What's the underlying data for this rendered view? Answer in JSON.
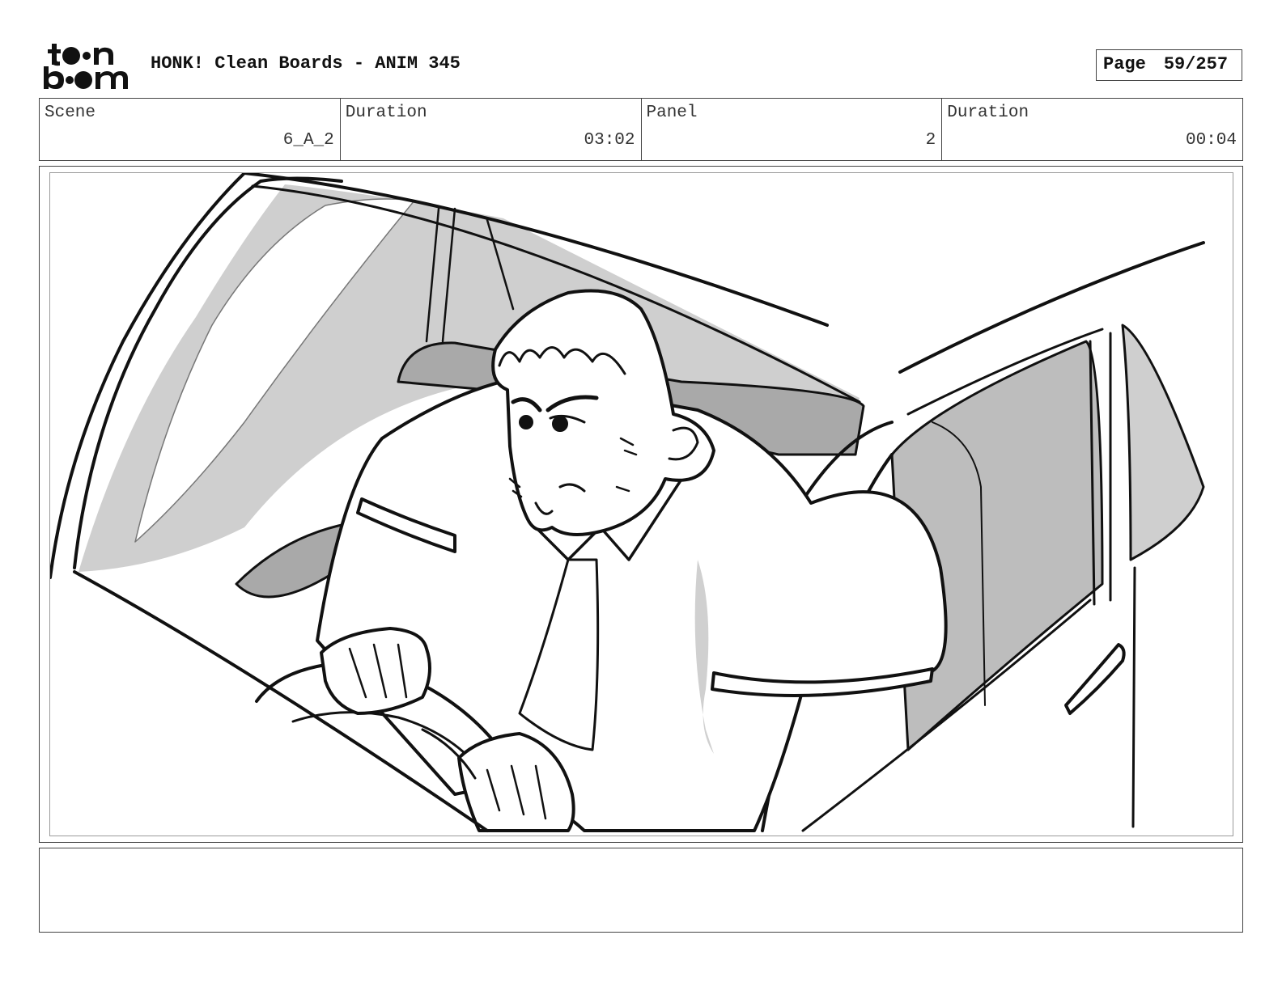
{
  "header": {
    "logo": "toon boom",
    "title": "HONK! Clean Boards - ANIM 345",
    "page_label": "Page",
    "page_number": "59/257"
  },
  "info": [
    {
      "label": "Scene",
      "value": "6_A_2"
    },
    {
      "label": "Duration",
      "value": "03:02"
    },
    {
      "label": "Panel",
      "value": "2"
    },
    {
      "label": "Duration",
      "value": "00:04"
    }
  ],
  "panel": {
    "image": "storyboard-drawing-man-driving-car"
  },
  "notes": {
    "text": ""
  }
}
